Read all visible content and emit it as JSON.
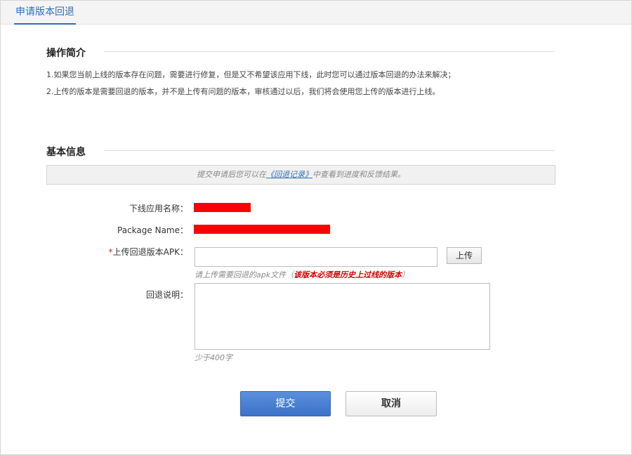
{
  "tab": {
    "label": "申请版本回退"
  },
  "intro_section": {
    "title": "操作简介",
    "line1": "1.如果您当前上线的版本存在问题，需要进行修复，但是又不希望该应用下线，此时您可以通过版本回退的办法来解决；",
    "line2": "2.上传的版本是需要回退的版本，并不是上传有问题的版本，审核通过以后，我们将会使用您上传的版本进行上线。"
  },
  "basic_section": {
    "title": "基本信息",
    "notice_prefix": "提交申请后您可以在",
    "notice_link": "《回退记录》",
    "notice_suffix": "中查看到进度和反馈结果。"
  },
  "form": {
    "app_name_label": "下线应用名称：",
    "package_name_label": "Package Name：",
    "apk_required_mark": "*",
    "apk_label": "上传回退版本APK：",
    "upload_button": "上传",
    "apk_hint_prefix": "请上传需要回退的apk文件（",
    "apk_hint_warn": "该版本必须是历史上过线的版本",
    "apk_hint_suffix": "）",
    "reason_label": "回退说明：",
    "reason_hint": "少于400字",
    "submit_button": "提交",
    "cancel_button": "取消"
  },
  "colors": {
    "accent": "#2f6fb5",
    "submit": "#4a80d3",
    "warning": "#d40000",
    "redaction": "#ff0000"
  }
}
